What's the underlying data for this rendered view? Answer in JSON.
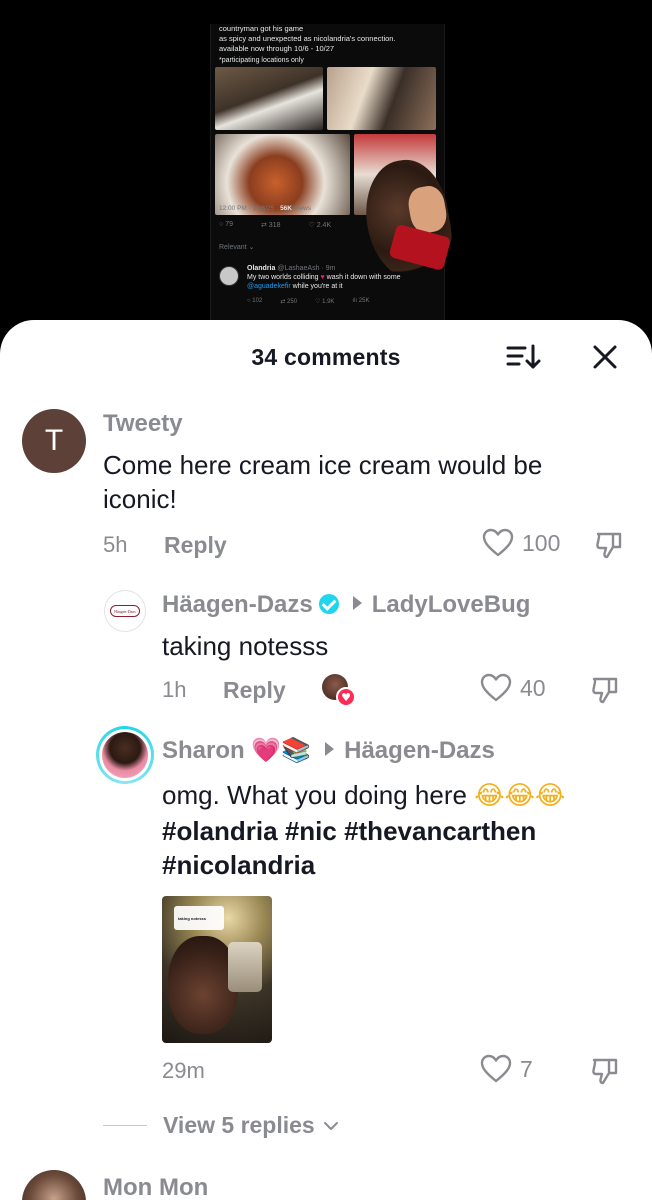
{
  "background_tweet": {
    "text_lines": [
      "countryman got his game",
      "as spicy and unexpected as nicolandria's connection.",
      "available now through 10/6 - 10/27"
    ],
    "note": "*participating locations only",
    "meta_time": "12:00 PM · 10/6/25 · ",
    "meta_views_count": "56K",
    "meta_views_label": " Views",
    "replies": "79",
    "reposts": "318",
    "likes": "2.4K",
    "relevant_label": "Relevant",
    "reply": {
      "name": "Olandria",
      "handle": "@LashaeAsh · 9m",
      "text_a": "My two worlds colliding ",
      "text_b": " wash it down with some",
      "mention": "@aguadekefir",
      "text_c": " while you're at it",
      "replies": "102",
      "reposts": "250",
      "likes": "1.9K",
      "views": "25K"
    }
  },
  "sheet": {
    "title": "34 comments"
  },
  "comments": [
    {
      "avatar_letter": "T",
      "avatar_color": "#5d4037",
      "username": "Tweety",
      "text_line1": "Come here cream ice cream would be",
      "text_line2": "iconic!",
      "time": "5h",
      "reply_label": "Reply",
      "likes": "100"
    }
  ],
  "reply1": {
    "username": "Häagen-Dazs",
    "reply_to": "LadyLoveBug",
    "avatar_logo_text": "Häagen-Dazs",
    "text": "taking notesss",
    "time": "1h",
    "reply_label": "Reply",
    "likes": "40"
  },
  "reply2": {
    "username": "Sharon",
    "name_emoji": "💗📚",
    "reply_to": "Häagen-Dazs",
    "text": "omg. What you doing here ",
    "text_emoji": "😂😂😂",
    "hashtags_line1": "#olandria #nic #thevancarthen",
    "hashtags_line2": "#nicolandria",
    "attached_overlay_text": "taking notesss",
    "time": "29m",
    "likes": "7"
  },
  "view_replies": "View 5 replies",
  "next_comment": {
    "username": "Mon Mon"
  },
  "colors": {
    "verified": "#20d5ec",
    "muted_text": "#8a8b91",
    "primary_text": "#161823",
    "heart_badge": "#fe2c55"
  }
}
